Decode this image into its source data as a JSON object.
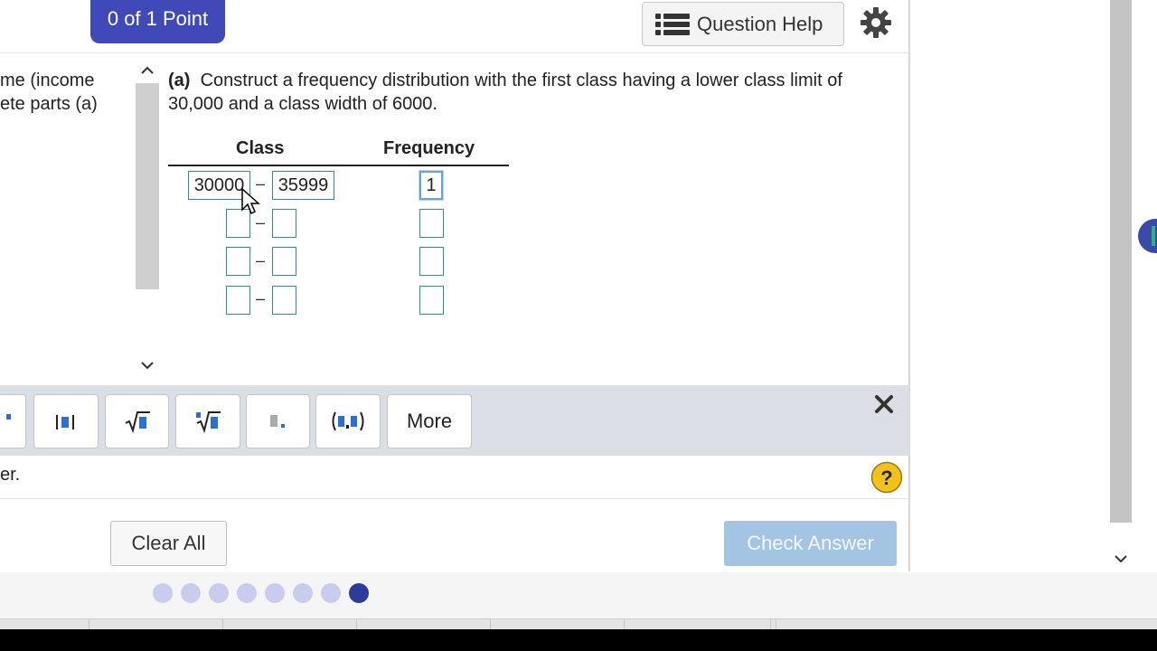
{
  "header": {
    "score": "0 of 1 Point",
    "question_help": "Question Help"
  },
  "left_pane": {
    "text_line1": "me (income",
    "text_line2": "ete parts (a)"
  },
  "question": {
    "part_label": "(a)",
    "prompt": "Construct a frequency distribution with the first class having a lower class limit of 30,000 and a class width of 6000."
  },
  "table": {
    "class_header": "Class",
    "frequency_header": "Frequency",
    "dash": "–",
    "rows": [
      {
        "lower": "30000",
        "upper": "35999",
        "frequency": "1"
      },
      {
        "lower": "",
        "upper": "",
        "frequency": ""
      },
      {
        "lower": "",
        "upper": "",
        "frequency": ""
      },
      {
        "lower": "",
        "upper": "",
        "frequency": ""
      }
    ]
  },
  "palette": {
    "more_label": "More",
    "buttons": [
      "fraction-partial",
      "mixed-number",
      "square-root",
      "nth-root",
      "decimal",
      "interval-notation"
    ]
  },
  "instruction_text": "er.",
  "buttons": {
    "clear_all": "Clear All",
    "check_answer": "Check Answer"
  },
  "progress": {
    "total": 8,
    "current": 8
  },
  "colors": {
    "badge": "#3f49b7",
    "input_border": "#2a8ea0",
    "check_answer_disabled": "#a4c4e4",
    "dot_inactive": "#c8cdee",
    "dot_current": "#2c3c9a",
    "help_yellow": "#f3c21a"
  }
}
